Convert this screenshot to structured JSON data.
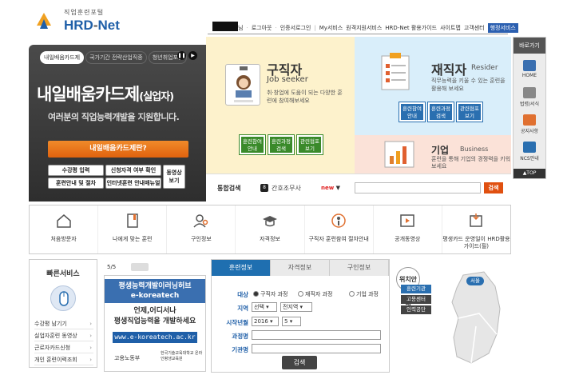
{
  "header": {
    "logo_sub": "직업훈련포털",
    "logo_main": "HRD",
    "logo_dash": "-",
    "logo_net": "Net",
    "user_suffix": "님",
    "nav": [
      "로그아웃",
      "인증서로그인",
      "My서비스",
      "원격지원서비스",
      "HRD-Net 활용가이드",
      "사이트맵",
      "고객센터"
    ],
    "nav_highlight": "행정서비스"
  },
  "banner": {
    "tabs": [
      "내일배움카드제",
      "국가기간 전략산업직종",
      "청년취업포털"
    ],
    "title": "내일배움카드제",
    "title_suffix": "(실업자)",
    "desc": "여러분의 직업능력개발을 지원합니다.",
    "limit_button": "내일배움카드제란?",
    "buttons": [
      "수강평 입력",
      "신청자격 여부 확인",
      "훈련안내 및 절차",
      "인터넷훈련 안내매뉴얼"
    ],
    "side_button": "동영상 보기"
  },
  "jobseeker": {
    "title": "구직자",
    "en": "Job seeker",
    "desc": "취·창업에 도움이 되는 다양한 훈련에 참여해보세요",
    "buttons": [
      "훈련참여 안내",
      "훈련과정 검색",
      "관련협포 보기"
    ]
  },
  "employee": {
    "title": "재직자",
    "en": "Resider",
    "desc": "직무능력을 키울 수 있는 훈련을 활용해 보세요",
    "buttons": [
      "훈련참여 안내",
      "훈련과정 검색",
      "관련협포 보기"
    ]
  },
  "business": {
    "title": "기업",
    "en": "Business",
    "desc": "훈련을 통해 기업의 경쟁력을 키워보세요"
  },
  "search": {
    "label": "통합검색",
    "badge": "8",
    "keyword": "간호조무사",
    "new_label": "new",
    "button": "검색"
  },
  "sidebar": {
    "head": "바로가기",
    "items": [
      "HOME",
      "법령/서식",
      "공지사항",
      "NCS안내"
    ],
    "top": "▲TOP"
  },
  "quick_menu": [
    "처음방문자",
    "나에게 맞는 훈련",
    "구인정보",
    "자격정보",
    "구직자 훈련참여 절차안내",
    "공개동영상",
    "평생카드 운영일이 HRD활용가이드(필)"
  ],
  "fast_service": {
    "title": "빠른서비스",
    "items": [
      "수강평 남기기",
      "실업자훈련 동영상",
      "근로자카드신청",
      "개인 훈련이력조회"
    ]
  },
  "ad": {
    "page": "5/5",
    "top1": "평생능력개발이러닝허브",
    "top2": "e-koreatech",
    "mid1": "언제,어디서나",
    "mid2": "평생직업능력을 개발하세요",
    "url": "www.e-koreatech.ac.kr",
    "foot1": "고용노동부",
    "foot2": "한국기술교육대학교 온라인평생교육원"
  },
  "training_form": {
    "tabs": [
      "훈련정보",
      "자격정보",
      "구인정보"
    ],
    "labels": [
      "대상",
      "지역",
      "시작년월",
      "과정명",
      "기관명"
    ],
    "radios": [
      "구직자 과정",
      "재직자 과정",
      "기업 과정"
    ],
    "region1": "선택",
    "region2": "전지역",
    "year": "2016",
    "month": "5",
    "button": "검색"
  },
  "location": {
    "title": "위치안내",
    "buttons": [
      "훈련기관",
      "고용센터",
      "인력공단"
    ],
    "region": "서울"
  }
}
